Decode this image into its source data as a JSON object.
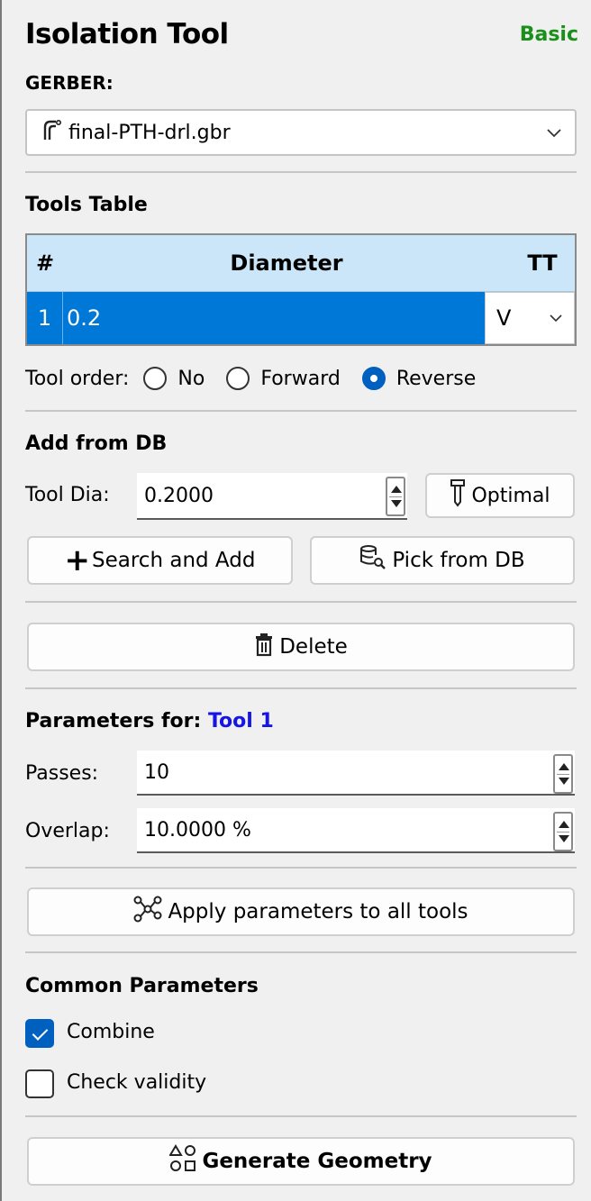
{
  "header": {
    "title": "Isolation Tool",
    "level": "Basic",
    "level_color": "#1a8f1a"
  },
  "object": {
    "label": "GERBER:",
    "selected": "final-PTH-drl.gbr",
    "icon": "gerber-file-icon"
  },
  "tools_table": {
    "label": "Tools Table",
    "headers": [
      "#",
      "Diameter",
      "TT"
    ],
    "rows": [
      {
        "index": "1",
        "diameter": "0.2",
        "tt": "V"
      }
    ],
    "selected_row_color": "#0078d7"
  },
  "tool_order": {
    "label": "Tool order:",
    "options": [
      "No",
      "Forward",
      "Reverse"
    ],
    "selected": "Reverse"
  },
  "add_from_db": {
    "label": "Add from DB",
    "tool_dia_label": "Tool Dia:",
    "tool_dia_value": "0.2000",
    "optimal_label": "Optimal",
    "search_add_label": "Search and Add",
    "pick_db_label": "Pick from DB"
  },
  "delete_label": "Delete",
  "parameters": {
    "label_prefix": "Parameters for:",
    "tool_name": "Tool 1",
    "tool_name_color": "#1515e6",
    "passes_label": "Passes:",
    "passes_value": "10",
    "overlap_label": "Overlap:",
    "overlap_value": "10.0000 %",
    "apply_label": "Apply parameters to all tools"
  },
  "common": {
    "label": "Common Parameters",
    "combine_label": "Combine",
    "combine_checked": true,
    "validity_label": "Check validity",
    "validity_checked": false
  },
  "generate_label": "Generate Geometry"
}
